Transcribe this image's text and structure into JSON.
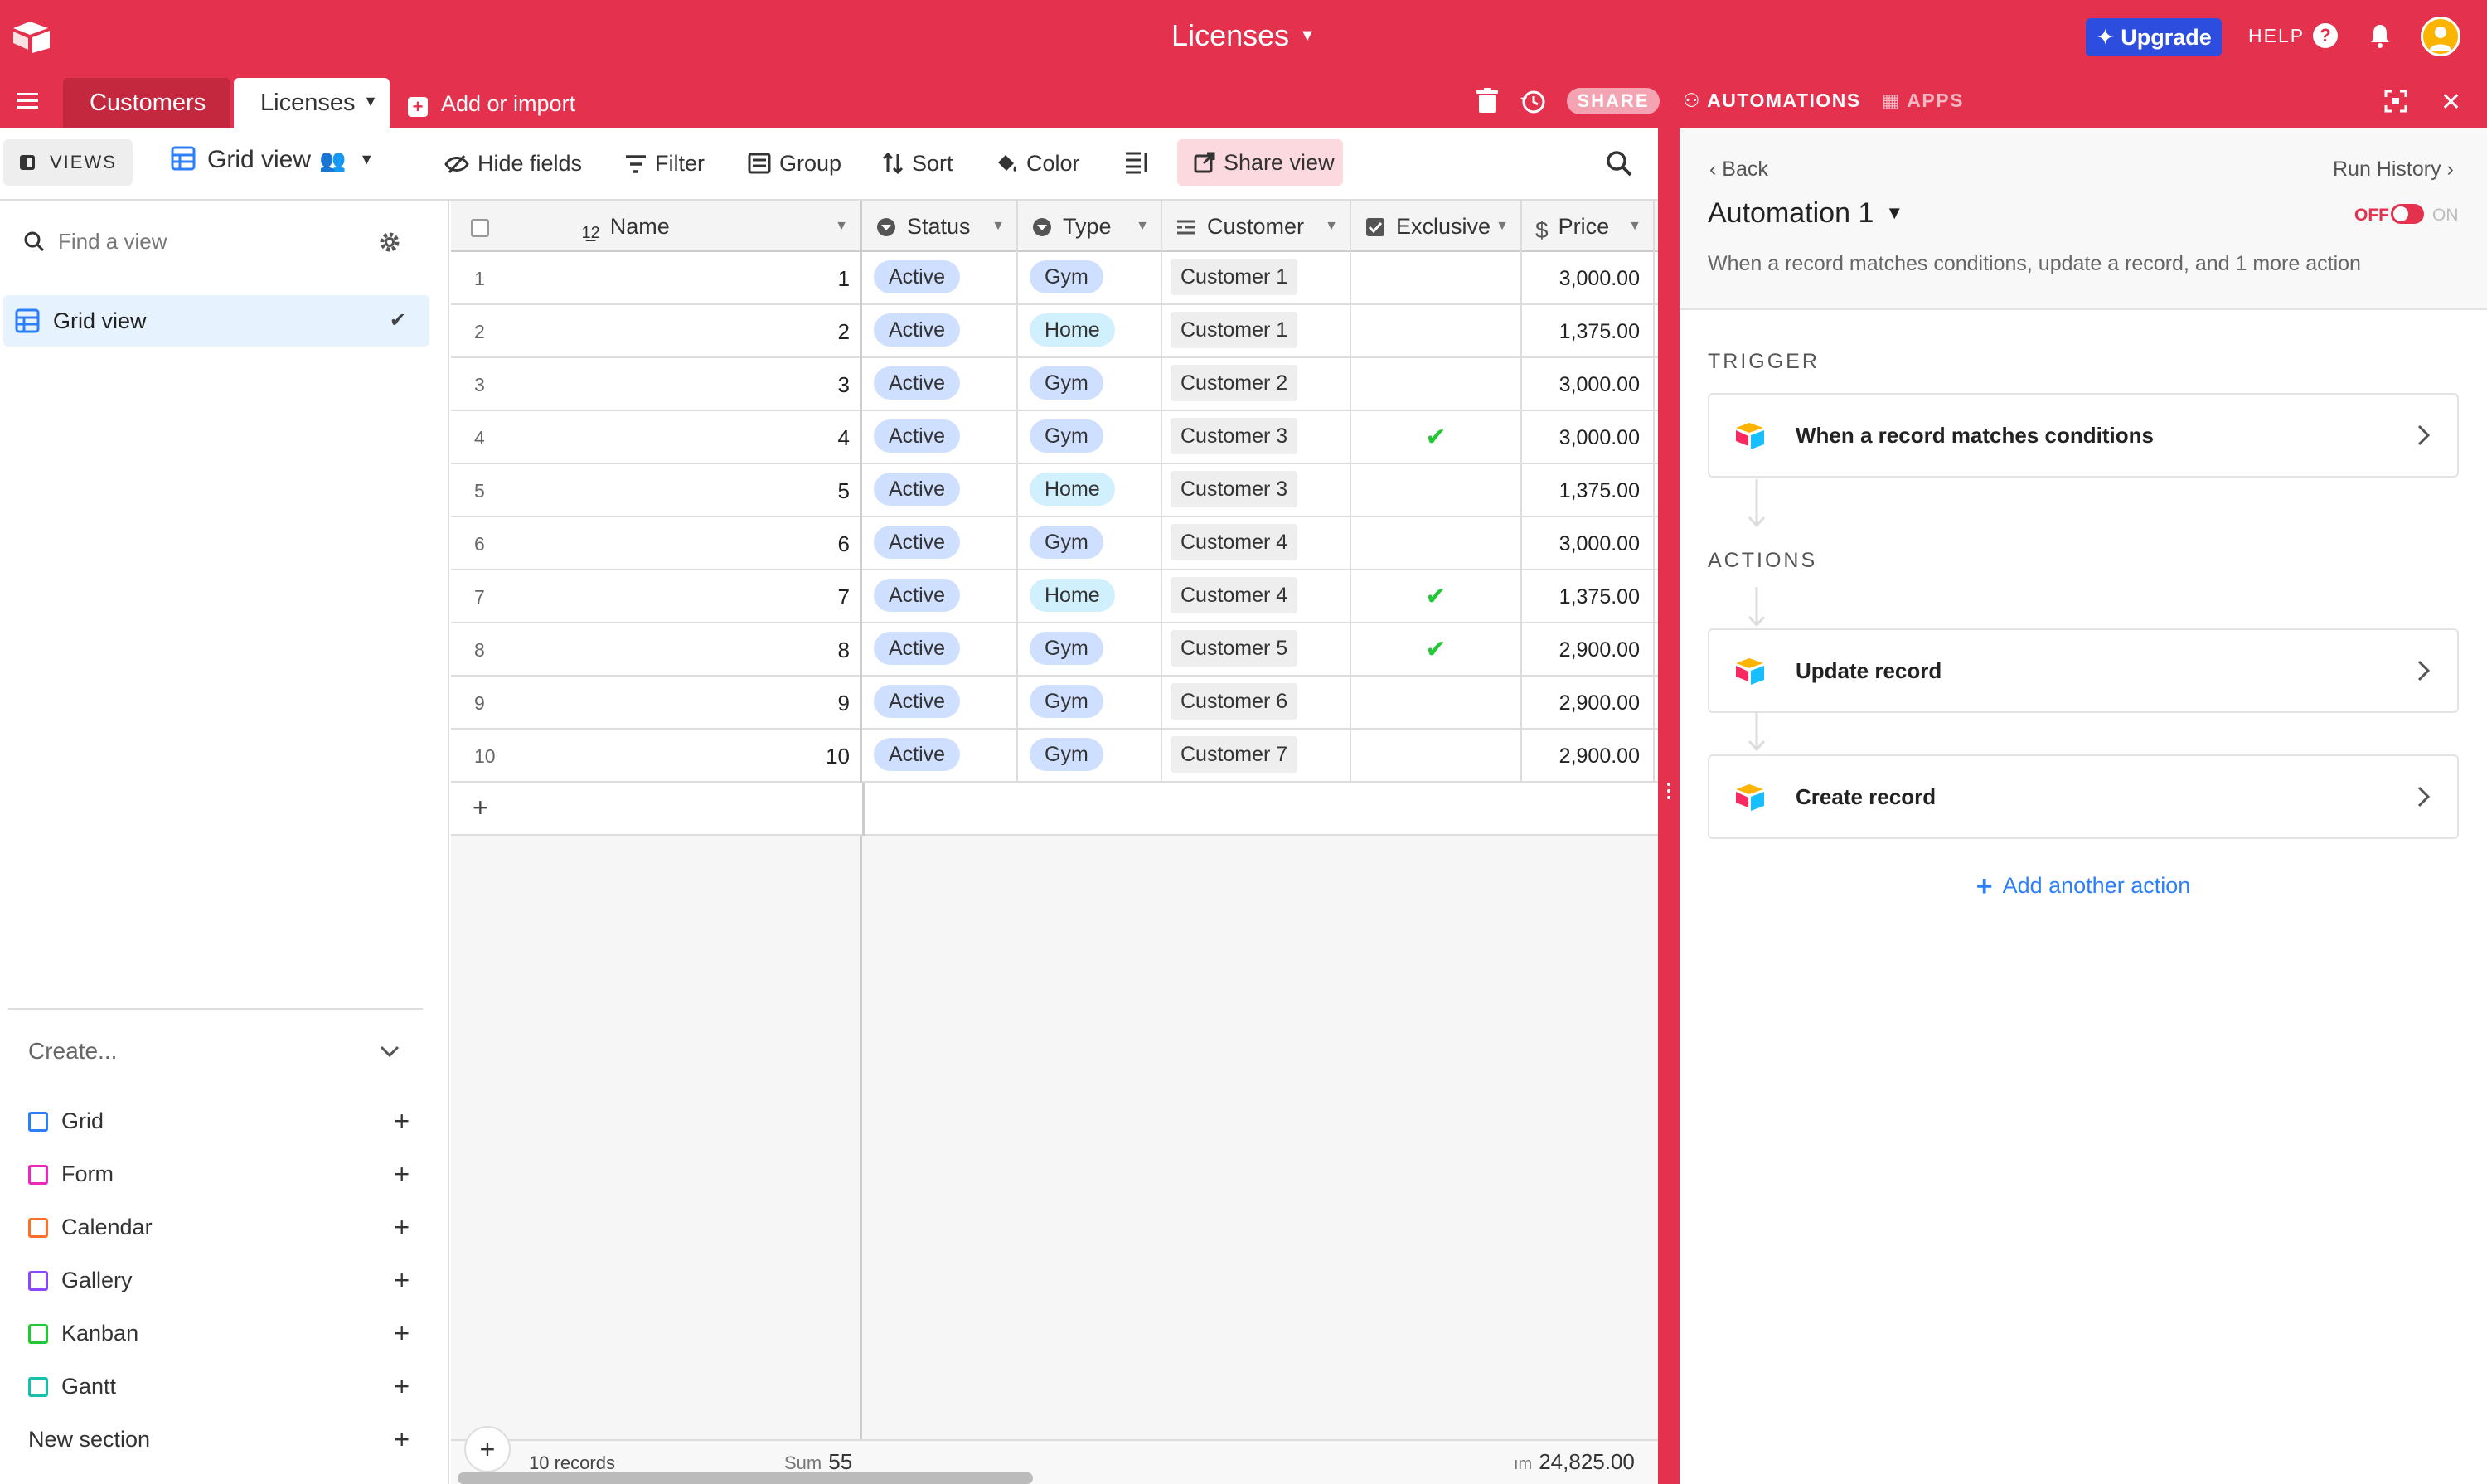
{
  "topbar": {
    "base_title": "Licenses",
    "upgrade_label": "Upgrade",
    "help_label": "HELP"
  },
  "tabs": {
    "customers": "Customers",
    "licenses": "Licenses",
    "add_import": "Add or import",
    "share": "SHARE",
    "automations": "AUTOMATIONS",
    "apps": "APPS"
  },
  "viewbar": {
    "views_label": "VIEWS",
    "view_name": "Grid view",
    "hide_fields": "Hide fields",
    "filter": "Filter",
    "group": "Group",
    "sort": "Sort",
    "color": "Color",
    "share_view": "Share view"
  },
  "sidebar": {
    "find_placeholder": "Find a view",
    "active_view": "Grid view",
    "create_title": "Create...",
    "create_items": [
      {
        "label": "Grid",
        "color": "#2d7ff9"
      },
      {
        "label": "Form",
        "color": "#e929ba"
      },
      {
        "label": "Calendar",
        "color": "#ff6f2c"
      },
      {
        "label": "Gallery",
        "color": "#8b46ff"
      },
      {
        "label": "Kanban",
        "color": "#20c933"
      },
      {
        "label": "Gantt",
        "color": "#18bfac"
      }
    ],
    "new_section": "New section"
  },
  "grid": {
    "columns": [
      "Name",
      "Status",
      "Type",
      "Customer",
      "Exclusive",
      "Price"
    ],
    "rows": [
      {
        "num": "1",
        "name": "1",
        "status": "Active",
        "type": "Gym",
        "customer": "Customer 1",
        "exclusive": false,
        "price": "3,000.00"
      },
      {
        "num": "2",
        "name": "2",
        "status": "Active",
        "type": "Home",
        "customer": "Customer 1",
        "exclusive": false,
        "price": "1,375.00"
      },
      {
        "num": "3",
        "name": "3",
        "status": "Active",
        "type": "Gym",
        "customer": "Customer 2",
        "exclusive": false,
        "price": "3,000.00"
      },
      {
        "num": "4",
        "name": "4",
        "status": "Active",
        "type": "Gym",
        "customer": "Customer 3",
        "exclusive": true,
        "price": "3,000.00"
      },
      {
        "num": "5",
        "name": "5",
        "status": "Active",
        "type": "Home",
        "customer": "Customer 3",
        "exclusive": false,
        "price": "1,375.00"
      },
      {
        "num": "6",
        "name": "6",
        "status": "Active",
        "type": "Gym",
        "customer": "Customer 4",
        "exclusive": false,
        "price": "3,000.00"
      },
      {
        "num": "7",
        "name": "7",
        "status": "Active",
        "type": "Home",
        "customer": "Customer 4",
        "exclusive": true,
        "price": "1,375.00"
      },
      {
        "num": "8",
        "name": "8",
        "status": "Active",
        "type": "Gym",
        "customer": "Customer 5",
        "exclusive": true,
        "price": "2,900.00"
      },
      {
        "num": "9",
        "name": "9",
        "status": "Active",
        "type": "Gym",
        "customer": "Customer 6",
        "exclusive": false,
        "price": "2,900.00"
      },
      {
        "num": "10",
        "name": "10",
        "status": "Active",
        "type": "Gym",
        "customer": "Customer 7",
        "exclusive": false,
        "price": "2,900.00"
      }
    ],
    "footer": {
      "records": "10 records",
      "sum_label": "Sum",
      "sum_value": "55",
      "price_sum_label": "ım",
      "price_sum_value": "24,825.00"
    }
  },
  "automation": {
    "back": "Back",
    "run_history": "Run History",
    "title": "Automation 1",
    "toggle_off": "OFF",
    "toggle_on": "ON",
    "description": "When a record matches conditions, update a record, and 1 more action",
    "trigger_label": "TRIGGER",
    "trigger": "When a record matches conditions",
    "actions_label": "ACTIONS",
    "actions": [
      "Update record",
      "Create record"
    ],
    "add_action": "Add another action"
  },
  "colors": {
    "brand_red": "#e4314d",
    "upgrade_blue": "#2d4dde",
    "link_blue": "#2d7ff9",
    "check_green": "#20c933"
  }
}
